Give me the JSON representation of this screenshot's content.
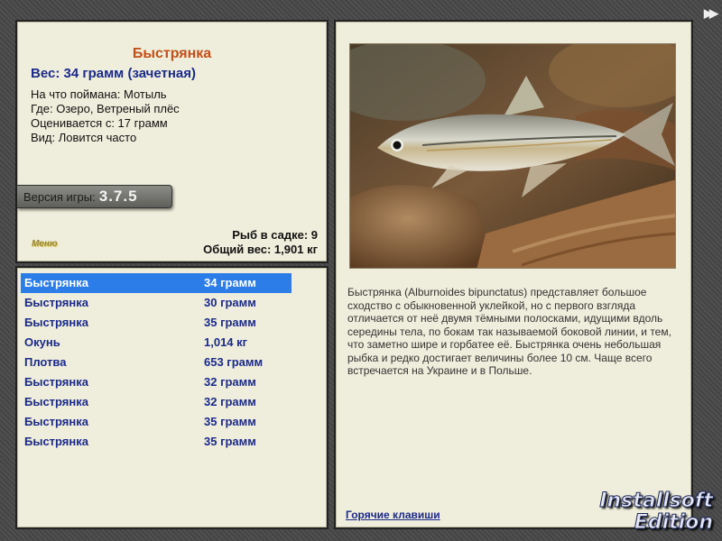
{
  "info": {
    "fish_name": "Быстрянка",
    "weight_line": "Вес: 34 грамм (зачетная)",
    "details": [
      "На что поймана: Мотыль",
      "Где: Озеро, Ветреный плёс",
      "Оценивается с: 17 грамм",
      "Вид: Ловится часто"
    ],
    "version_label": "Версия игры:",
    "version_value": "3.7.5",
    "menu_logo": "Меню",
    "fish_in_cage": "Рыб в садке: 9",
    "total_weight": "Общий вес: 1,901 кг"
  },
  "catch": [
    {
      "name": "Быстрянка",
      "weight": "34 грамм",
      "selected": true
    },
    {
      "name": "Быстрянка",
      "weight": "30 грамм"
    },
    {
      "name": "Быстрянка",
      "weight": "35 грамм"
    },
    {
      "name": "Окунь",
      "weight": "1,014 кг"
    },
    {
      "name": "Плотва",
      "weight": "653 грамм"
    },
    {
      "name": "Быстрянка",
      "weight": "32 грамм"
    },
    {
      "name": "Быстрянка",
      "weight": "32 грамм"
    },
    {
      "name": "Быстрянка",
      "weight": "35 грамм"
    },
    {
      "name": "Быстрянка",
      "weight": "35 грамм"
    }
  ],
  "detail": {
    "description": "Быстрянка (Alburnoides bipunctatus) представляет большое сходство с обыкновенной уклейкой, но с первого взгляда отличается от неё двумя тёмными полосками, идущими вдоль середины тела, по бокам так называемой боковой линии, и тем, что заметно шире и горбатее её. Быстрянка очень небольшая рыбка и редко достигает величины более 10 см. Чаще всего встречается на Украине и в Польше.",
    "hotkeys_label": "Горячие клавиши"
  },
  "nav": {
    "forward_icon": "fast-forward-icon",
    "forward_symbol": "▶▶"
  },
  "watermark": {
    "line1": "Installsoft",
    "line2": "Edition"
  },
  "colors": {
    "accent_title": "#c0501a",
    "accent_blue": "#1a2a8a",
    "selection": "#2c7de8",
    "panel_bg": "#efeddb"
  }
}
